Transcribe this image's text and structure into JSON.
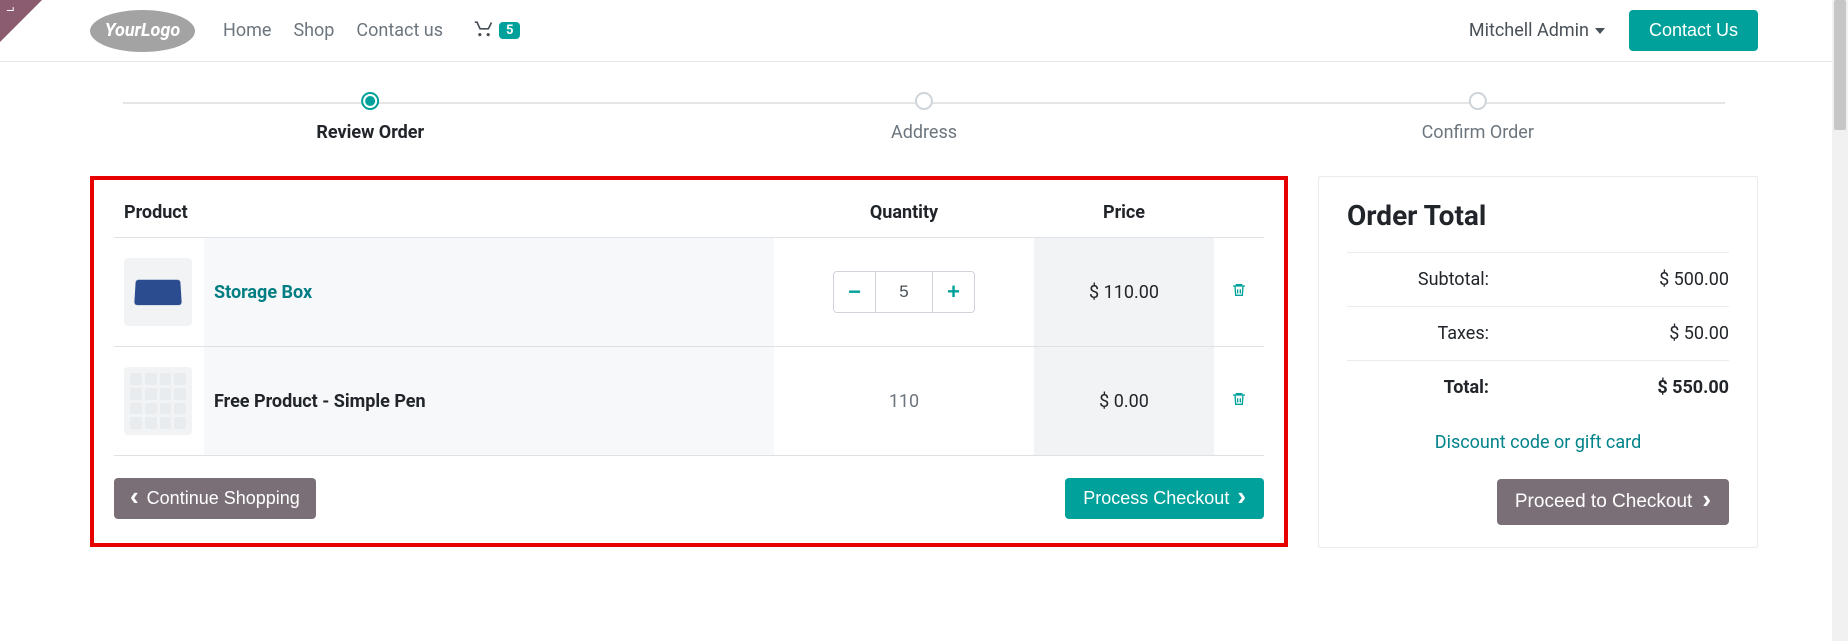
{
  "nav": {
    "links": [
      "Home",
      "Shop",
      "Contact us"
    ],
    "cart_count": "5",
    "user": "Mitchell Admin",
    "contact_btn": "Contact Us",
    "logo_text": "YourLogo"
  },
  "stepper": {
    "steps": [
      "Review Order",
      "Address",
      "Confirm Order"
    ],
    "active_index": 0
  },
  "cart": {
    "headers": {
      "product": "Product",
      "quantity": "Quantity",
      "price": "Price"
    },
    "rows": [
      {
        "name": "Storage Box",
        "is_link": true,
        "qty": "5",
        "qty_editable": true,
        "price": "$ 110.00"
      },
      {
        "name": "Free Product - Simple Pen",
        "is_link": false,
        "qty": "110",
        "qty_editable": false,
        "price": "$ 0.00"
      }
    ],
    "continue_btn": "Continue Shopping",
    "process_btn": "Process Checkout"
  },
  "totals": {
    "title": "Order Total",
    "rows": [
      {
        "label": "Subtotal:",
        "value": "$ 500.00",
        "bold": false
      },
      {
        "label": "Taxes:",
        "value": "$ 50.00",
        "bold": false
      },
      {
        "label": "Total:",
        "value": "$ 550.00",
        "bold": true
      }
    ],
    "discount_link": "Discount code or gift card",
    "proceed_btn": "Proceed to Checkout"
  }
}
